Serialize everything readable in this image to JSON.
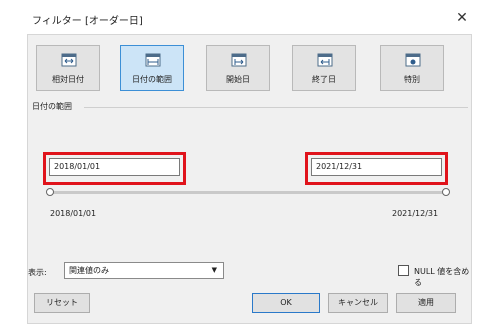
{
  "window": {
    "title": "フィルター [オーダー日]"
  },
  "tabs": [
    {
      "label": "相対日付",
      "icon": "calendar-relative-icon"
    },
    {
      "label": "日付の範囲",
      "icon": "calendar-range-icon",
      "active": true
    },
    {
      "label": "開始日",
      "icon": "calendar-start-icon"
    },
    {
      "label": "終了日",
      "icon": "calendar-end-icon"
    },
    {
      "label": "特別",
      "icon": "calendar-special-icon"
    }
  ],
  "range": {
    "section_title": "日付の範囲",
    "start_value": "2018/01/01",
    "end_value": "2021/12/31",
    "min_label": "2018/01/01",
    "max_label": "2021/12/31"
  },
  "show": {
    "label": "表示:",
    "selected": "関連値のみ"
  },
  "include_null": {
    "label": "NULL 値を含める",
    "checked": false
  },
  "buttons": {
    "reset": "リセット",
    "ok": "OK",
    "cancel": "キャンセル",
    "apply": "適用"
  },
  "colors": {
    "highlight": "#e0131b",
    "active_tab": "#cce4f7",
    "active_border": "#3c8fd6"
  }
}
